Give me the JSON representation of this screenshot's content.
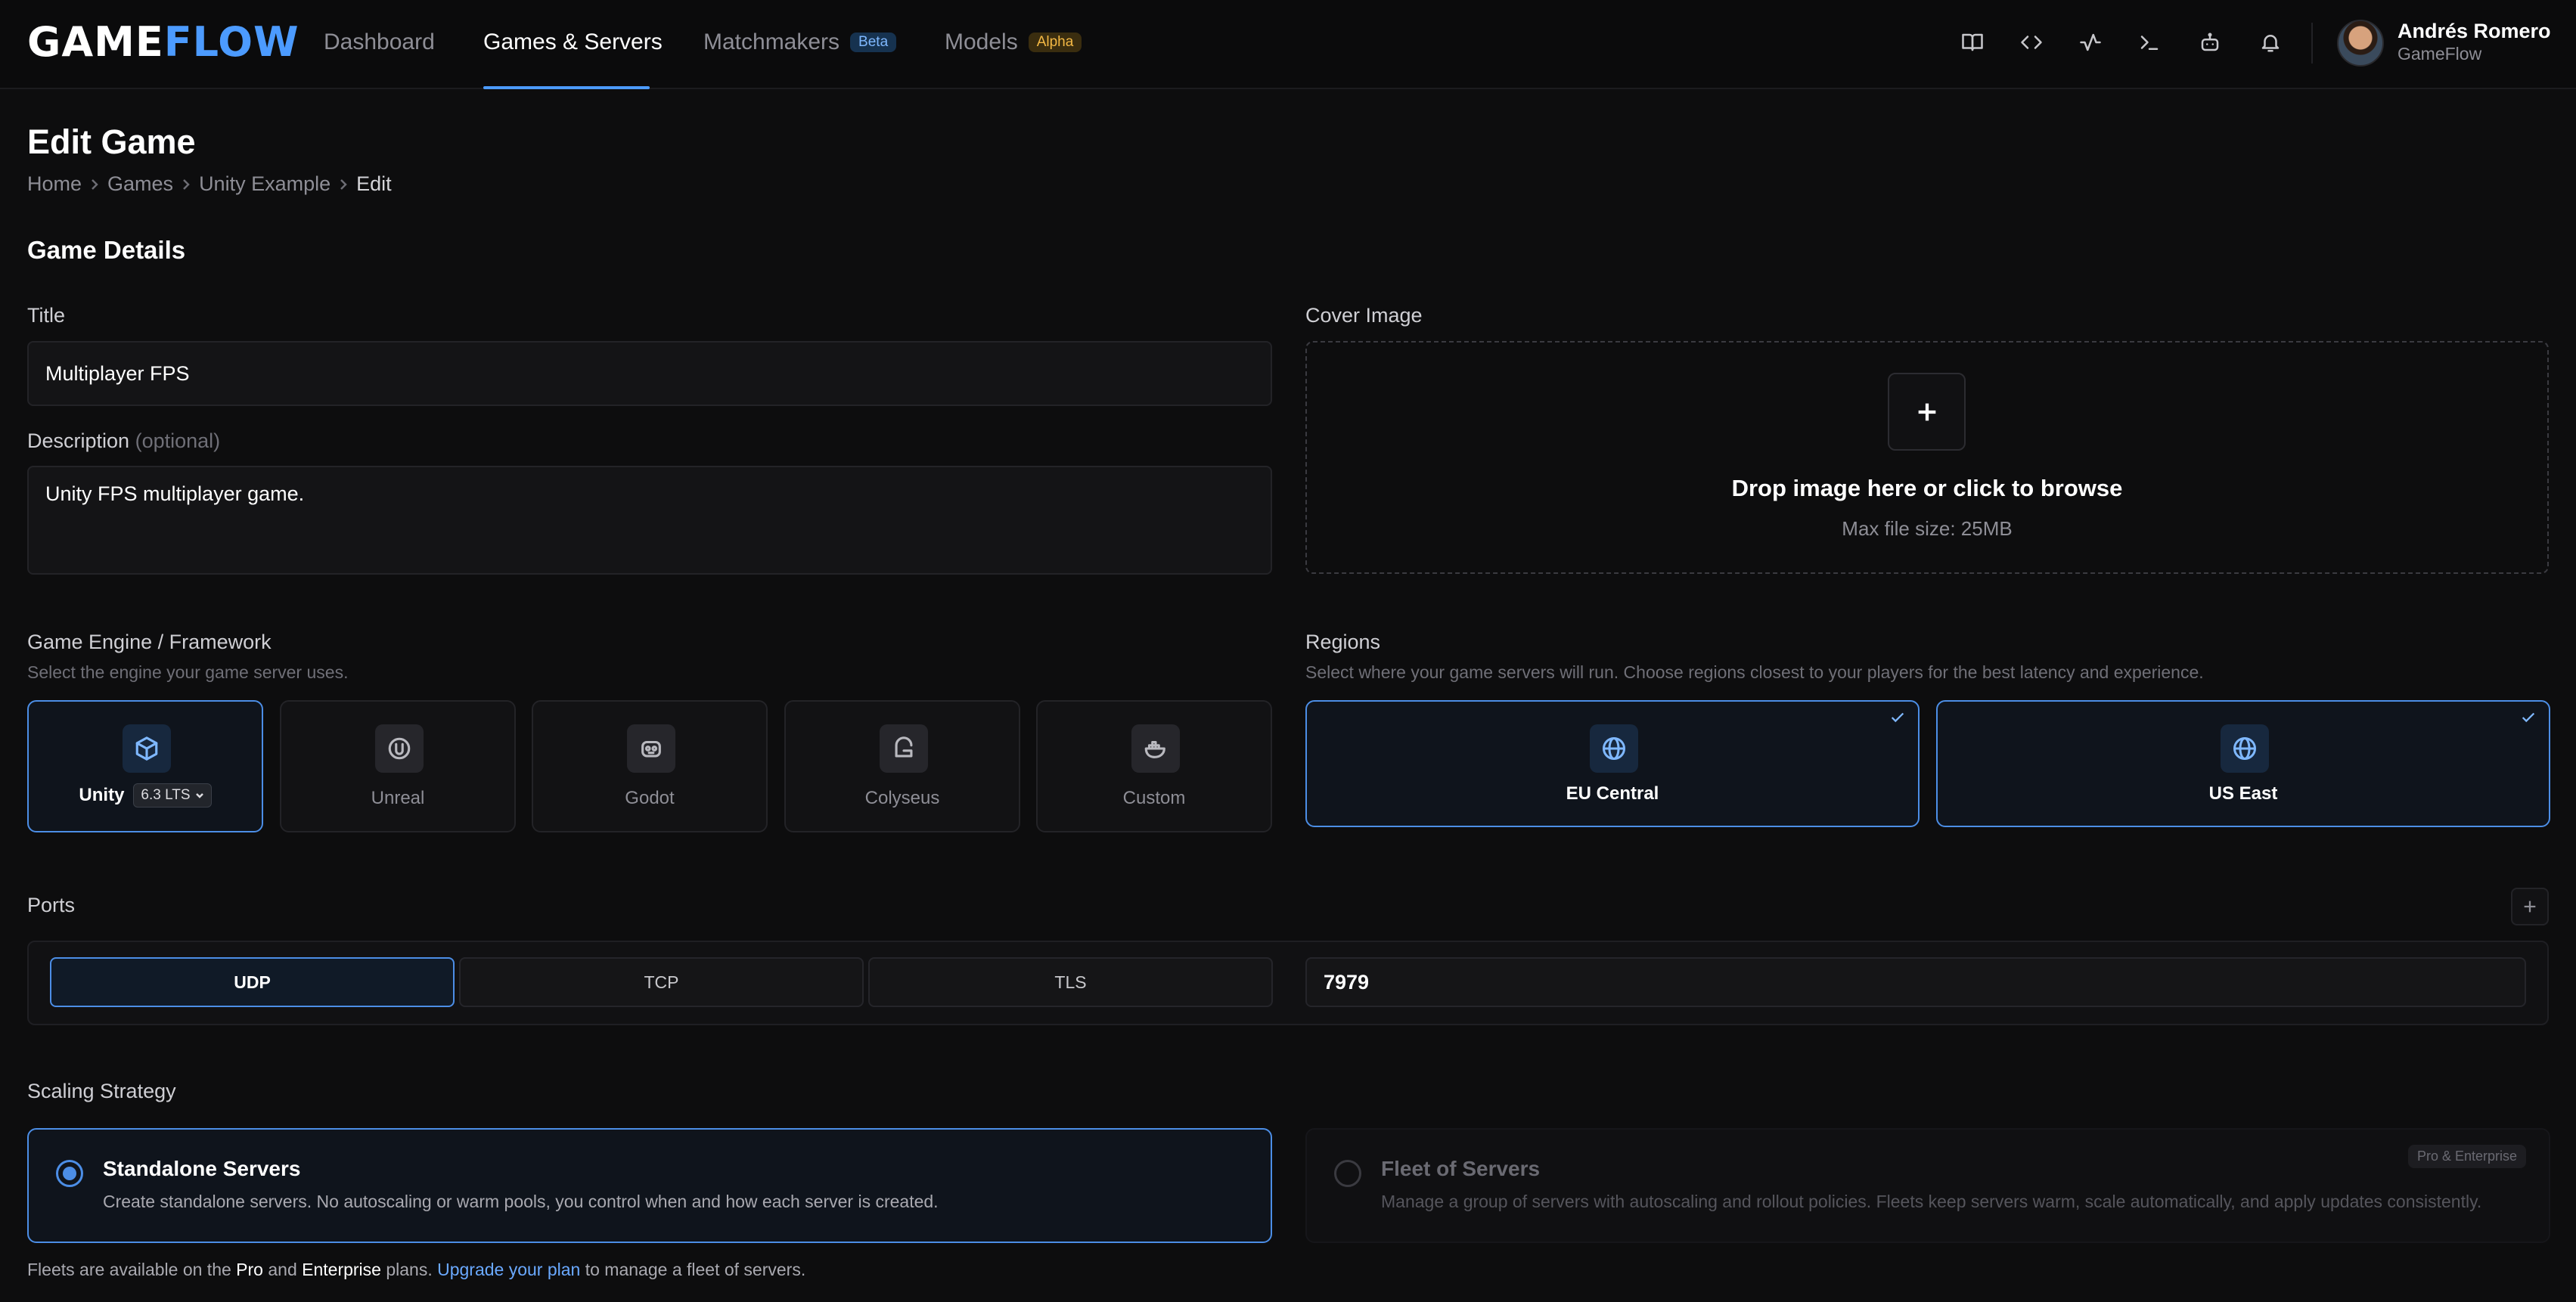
{
  "nav": {
    "logo_part1": "GAME",
    "logo_part2": "FLOW",
    "links": [
      {
        "label": "Dashboard"
      },
      {
        "label": "Games & Servers"
      },
      {
        "label": "Matchmakers",
        "badge": "Beta"
      },
      {
        "label": "Models",
        "badge": "Alpha"
      }
    ],
    "active_link": "Games & Servers",
    "icons": [
      "book-icon",
      "code-icon",
      "activity-icon",
      "terminal-icon",
      "robot-icon",
      "bell-icon"
    ],
    "user": {
      "name": "Andrés Romero",
      "org": "GameFlow"
    }
  },
  "page": {
    "title": "Edit Game",
    "breadcrumb": [
      "Home",
      "Games",
      "Unity Example",
      "Edit"
    ]
  },
  "details": {
    "section_title": "Game Details",
    "title_label": "Title",
    "title_value": "Multiplayer FPS",
    "description_label": "Description",
    "description_optional": "(optional)",
    "description_value": "Unity FPS multiplayer game.",
    "cover_label": "Cover Image",
    "cover_drop_text": "Drop image here or click to browse",
    "cover_max_size": "Max file size: 25MB"
  },
  "engine": {
    "label": "Game Engine / Framework",
    "help": "Select the engine your game server uses.",
    "options": [
      {
        "name": "Unity",
        "icon": "unity-icon",
        "version": "6.3 LTS",
        "selected": true
      },
      {
        "name": "Unreal",
        "icon": "unreal-icon",
        "selected": false
      },
      {
        "name": "Godot",
        "icon": "godot-icon",
        "selected": false
      },
      {
        "name": "Colyseus",
        "icon": "colyseus-icon",
        "selected": false
      },
      {
        "name": "Custom",
        "icon": "docker-icon",
        "selected": false
      }
    ]
  },
  "regions": {
    "label": "Regions",
    "help": "Select where your game servers will run. Choose regions closest to your players for the best latency and experience.",
    "options": [
      {
        "name": "EU Central",
        "selected": true
      },
      {
        "name": "US East",
        "selected": true
      }
    ]
  },
  "ports": {
    "label": "Ports",
    "protocols": [
      "UDP",
      "TCP",
      "TLS"
    ],
    "selected_protocol": "UDP",
    "port_value": "7979"
  },
  "scaling": {
    "label": "Scaling Strategy",
    "options": [
      {
        "title": "Standalone Servers",
        "description": "Create standalone servers. No autoscaling or warm pools, you control when and how each server is created.",
        "selected": true
      },
      {
        "title": "Fleet of Servers",
        "description": "Manage a group of servers with autoscaling and rollout policies. Fleets keep servers warm, scale automatically, and apply updates consistently.",
        "badge": "Pro & Enterprise",
        "disabled": true
      }
    ],
    "note": {
      "part1": "Fleets are available on the ",
      "pro": "Pro",
      "part2": " and ",
      "enterprise": "Enterprise",
      "part3": " plans. ",
      "link": "Upgrade your plan",
      "part4": " to manage a fleet of servers."
    }
  },
  "colors": {
    "accent": "#4c8ee6",
    "brand_flow": "#4c9bff",
    "background": "#0d0d0e"
  }
}
